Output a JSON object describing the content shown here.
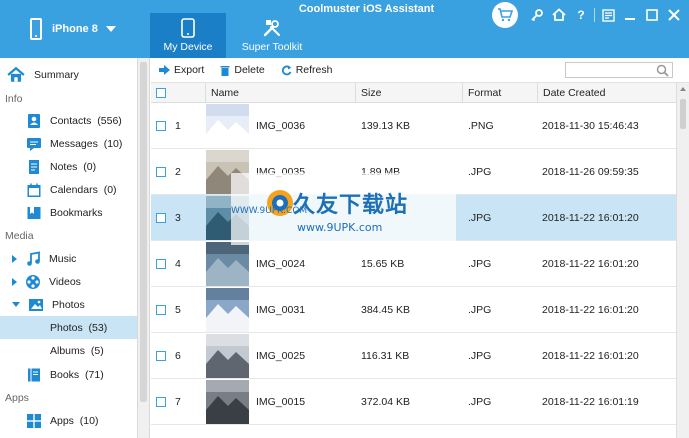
{
  "app": {
    "title": "Coolmuster iOS Assistant"
  },
  "device": {
    "name": "iPhone 8"
  },
  "tabs": [
    {
      "label": "My Device"
    },
    {
      "label": "Super Toolkit"
    }
  ],
  "sidebar": {
    "summary": "Summary",
    "sections": {
      "info": "Info",
      "media": "Media",
      "apps": "Apps"
    },
    "info_items": [
      {
        "label": "Contacts",
        "count": "(556)"
      },
      {
        "label": "Messages",
        "count": "(10)"
      },
      {
        "label": "Notes",
        "count": "(0)"
      },
      {
        "label": "Calendars",
        "count": "(0)"
      },
      {
        "label": "Bookmarks",
        "count": ""
      }
    ],
    "media_items": [
      {
        "label": "Music",
        "count": ""
      },
      {
        "label": "Videos",
        "count": ""
      },
      {
        "label": "Photos",
        "count": ""
      }
    ],
    "photo_sub": [
      {
        "label": "Photos",
        "count": "(53)"
      },
      {
        "label": "Albums",
        "count": "(5)"
      }
    ],
    "books": {
      "label": "Books",
      "count": "(71)"
    },
    "apps_item": {
      "label": "Apps",
      "count": "(10)"
    }
  },
  "toolbar": {
    "export": "Export",
    "delete": "Delete",
    "refresh": "Refresh",
    "search_placeholder": ""
  },
  "table": {
    "columns": {
      "name": "Name",
      "size": "Size",
      "format": "Format",
      "date": "Date Created"
    },
    "rows": [
      {
        "index": "1",
        "name": "IMG_0036",
        "size": "139.13 KB",
        "format": ".PNG",
        "date": "2018-11-30 15:46:43"
      },
      {
        "index": "2",
        "name": "IMG_0035",
        "size": "1.89 MB",
        "format": ".JPG",
        "date": "2018-11-26 09:59:35"
      },
      {
        "index": "3",
        "name": "",
        "size": "",
        "format": ".JPG",
        "date": "2018-11-22 16:01:20"
      },
      {
        "index": "4",
        "name": "IMG_0024",
        "size": "15.65 KB",
        "format": ".JPG",
        "date": "2018-11-22 16:01:20"
      },
      {
        "index": "5",
        "name": "IMG_0031",
        "size": "384.45 KB",
        "format": ".JPG",
        "date": "2018-11-22 16:01:20"
      },
      {
        "index": "6",
        "name": "IMG_0025",
        "size": "116.31 KB",
        "format": ".JPG",
        "date": "2018-11-22 16:01:20"
      },
      {
        "index": "7",
        "name": "IMG_0015",
        "size": "372.04 KB",
        "format": ".JPG",
        "date": "2018-11-22 16:01:19"
      }
    ]
  },
  "watermark": {
    "brand": "久友下载站",
    "url": "www.9UPK.com",
    "url_small": "WWW.9UPK.COM"
  },
  "colors": {
    "header": "#3aa1e0",
    "active_tab": "#1a7fc6",
    "selected_row": "#c9e4f5",
    "accent": "#1f8ad4"
  }
}
